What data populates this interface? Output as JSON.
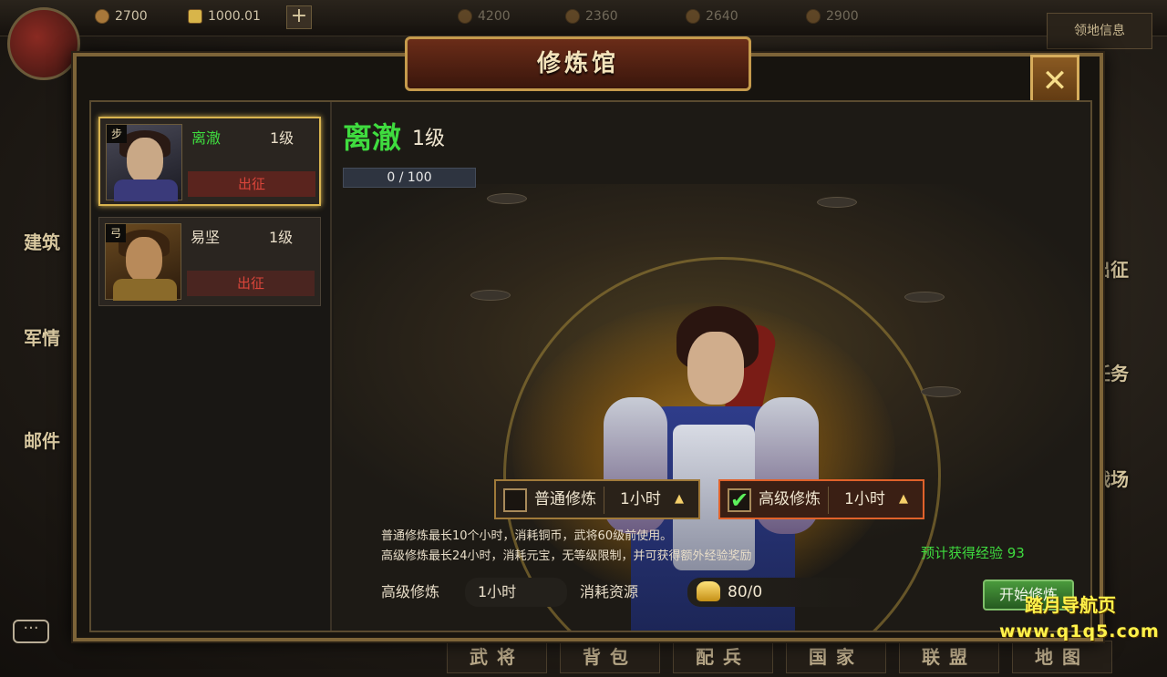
{
  "topbar": {
    "copper": "2700",
    "gold": "1000.01",
    "res3": "4200",
    "res4": "2360",
    "res5": "2640",
    "res6": "2900",
    "badge": "领地信息"
  },
  "side_left": [
    "建筑",
    "军情",
    "邮件"
  ],
  "side_right": [
    "出征",
    "任务",
    "战场"
  ],
  "bottom_nav": [
    "武将",
    "背包",
    "配兵",
    "国家",
    "联盟",
    "地图"
  ],
  "dialog": {
    "title": "修炼馆",
    "close_icon": "close-x-icon"
  },
  "heroes": [
    {
      "tag": "步",
      "name": "离澈",
      "level": "1级",
      "action": "出征",
      "name_color": "#3fdc3f",
      "selected": true
    },
    {
      "tag": "弓",
      "name": "易坚",
      "level": "1级",
      "action": "出征",
      "name_color": "#e8ddc8",
      "selected": false
    }
  ],
  "detail": {
    "name": "离澈",
    "level": "1级",
    "xp": "0 / 100"
  },
  "options": [
    {
      "label": "普通修炼",
      "duration": "1小时",
      "checked": false,
      "check": ""
    },
    {
      "label": "高级修炼",
      "duration": "1小时",
      "checked": true,
      "check": "✔"
    }
  ],
  "description": {
    "line1": "普通修炼最长10个小时，消耗铜币，武将60级前使用。",
    "line2": "高级修炼最长24小时，消耗元宝，无等级限制，并可获得额外经验奖励"
  },
  "expected_exp": "预计获得经验 93",
  "footer": {
    "mode_label": "高级修炼",
    "mode_value": "1小时",
    "cost_label": "消耗资源",
    "cost_value": "80/0",
    "start_button": "开始修炼"
  },
  "watermark": {
    "line1": "踏月导航页",
    "line2": "www.q1q5.com"
  },
  "chat_icon": "···"
}
